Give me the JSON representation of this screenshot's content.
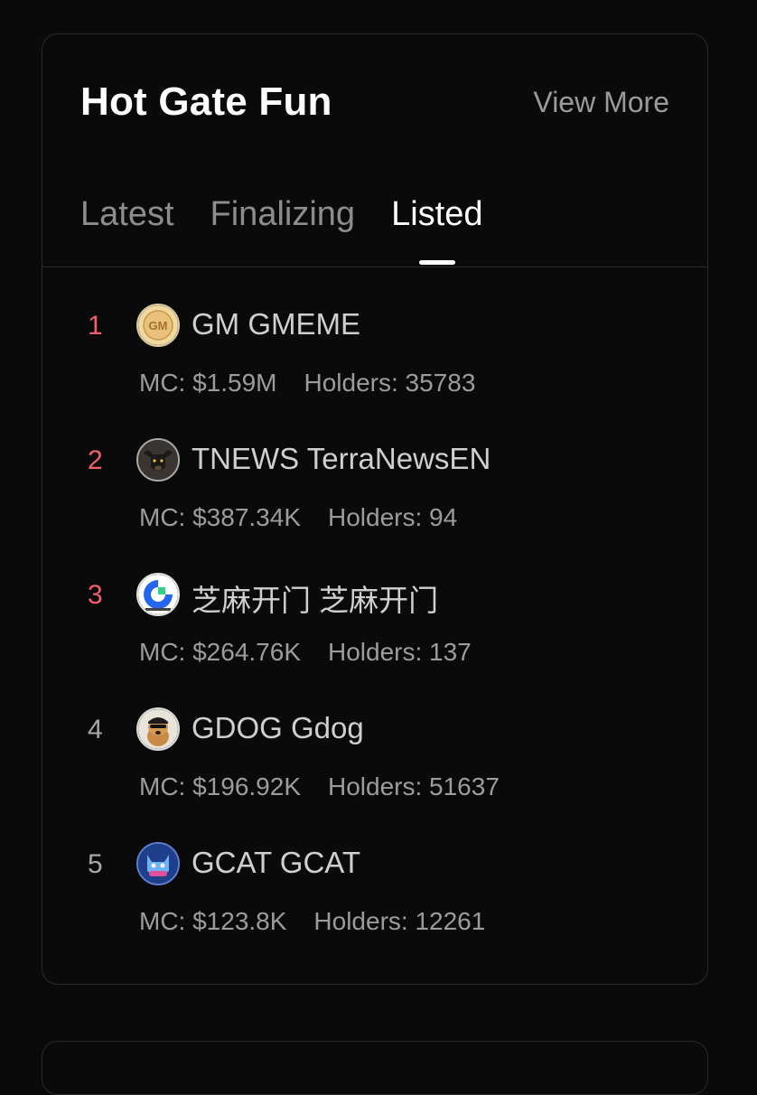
{
  "card": {
    "title": "Hot Gate Fun",
    "view_more": "View More"
  },
  "tabs": [
    {
      "label": "Latest",
      "active": false
    },
    {
      "label": "Finalizing",
      "active": false
    },
    {
      "label": "Listed",
      "active": true
    }
  ],
  "tokens": [
    {
      "rank": "1",
      "name": "GM GMEME",
      "mc": "MC: $1.59M",
      "holders": "Holders: 35783",
      "avatar_icon": "gm-coin-icon",
      "avatar_text": "GM"
    },
    {
      "rank": "2",
      "name": "TNEWS TerraNewsEN",
      "mc": "MC: $387.34K",
      "holders": "Holders: 94",
      "avatar_icon": "bull-icon"
    },
    {
      "rank": "3",
      "name": "芝麻开门 芝麻开门",
      "mc": "MC: $264.76K",
      "holders": "Holders: 137",
      "avatar_icon": "gate-logo-icon"
    },
    {
      "rank": "4",
      "name": "GDOG Gdog",
      "mc": "MC: $196.92K",
      "holders": "Holders: 51637",
      "avatar_icon": "dog-icon"
    },
    {
      "rank": "5",
      "name": "GCAT GCAT",
      "mc": "MC: $123.8K",
      "holders": "Holders: 12261",
      "avatar_icon": "cat-icon"
    }
  ],
  "colors": {
    "background": "#0a0a0a",
    "top_rank": "#f0606c",
    "rank": "#a8a8a8",
    "title": "#ffffff",
    "muted": "#9c9c9c"
  }
}
